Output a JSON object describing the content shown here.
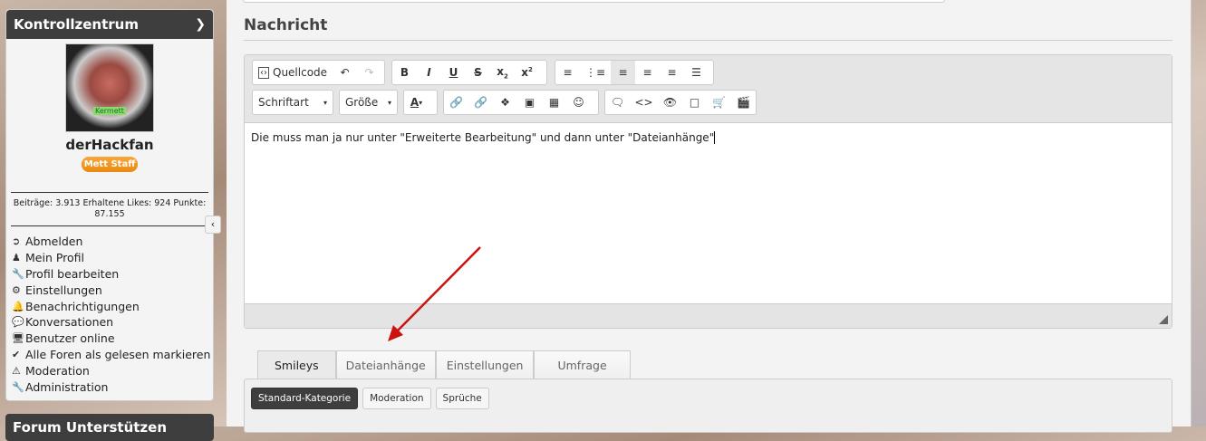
{
  "sidebar": {
    "title": "Kontrollzentrum",
    "avatar_caption": "Kermett",
    "username": "derHackfan",
    "badge": "Mett Staff",
    "stats": "Beiträge: 3.913   Erhaltene Likes: 924   Punkte: 87.155",
    "menu": [
      {
        "label": "Abmelden",
        "icon": "sign-out-icon"
      },
      {
        "label": "Mein Profil",
        "icon": "user-icon"
      },
      {
        "label": "Profil bearbeiten",
        "icon": "wrench-icon"
      },
      {
        "label": "Einstellungen",
        "icon": "gears-icon"
      },
      {
        "label": "Benachrichtigungen",
        "icon": "bell-icon"
      },
      {
        "label": "Konversationen",
        "icon": "comments-icon"
      },
      {
        "label": "Benutzer online",
        "icon": "desktop-icon"
      },
      {
        "label": "Alle Foren als gelesen markieren",
        "icon": "check-icon"
      },
      {
        "label": "Moderation",
        "icon": "warning-icon"
      },
      {
        "label": "Administration",
        "icon": "wrench-icon"
      }
    ],
    "second_box_title": "Forum Unterstützen"
  },
  "main": {
    "title": "Nachricht",
    "toolbar": {
      "source": "Quellcode",
      "font": "Schriftart",
      "size": "Größe",
      "color_label": "A"
    },
    "content": "Die muss man ja nur unter \"Erweiterte Bearbeitung\" und dann unter \"Dateianhänge\"",
    "tabs": [
      "Smileys",
      "Dateianhänge",
      "Einstellungen",
      "Umfrage"
    ],
    "categories": [
      "Standard-Kategorie",
      "Moderation",
      "Sprüche"
    ]
  },
  "colors": {
    "header": "#3e3e3e",
    "badge": "#ee9420",
    "arrow": "#cc1111"
  }
}
